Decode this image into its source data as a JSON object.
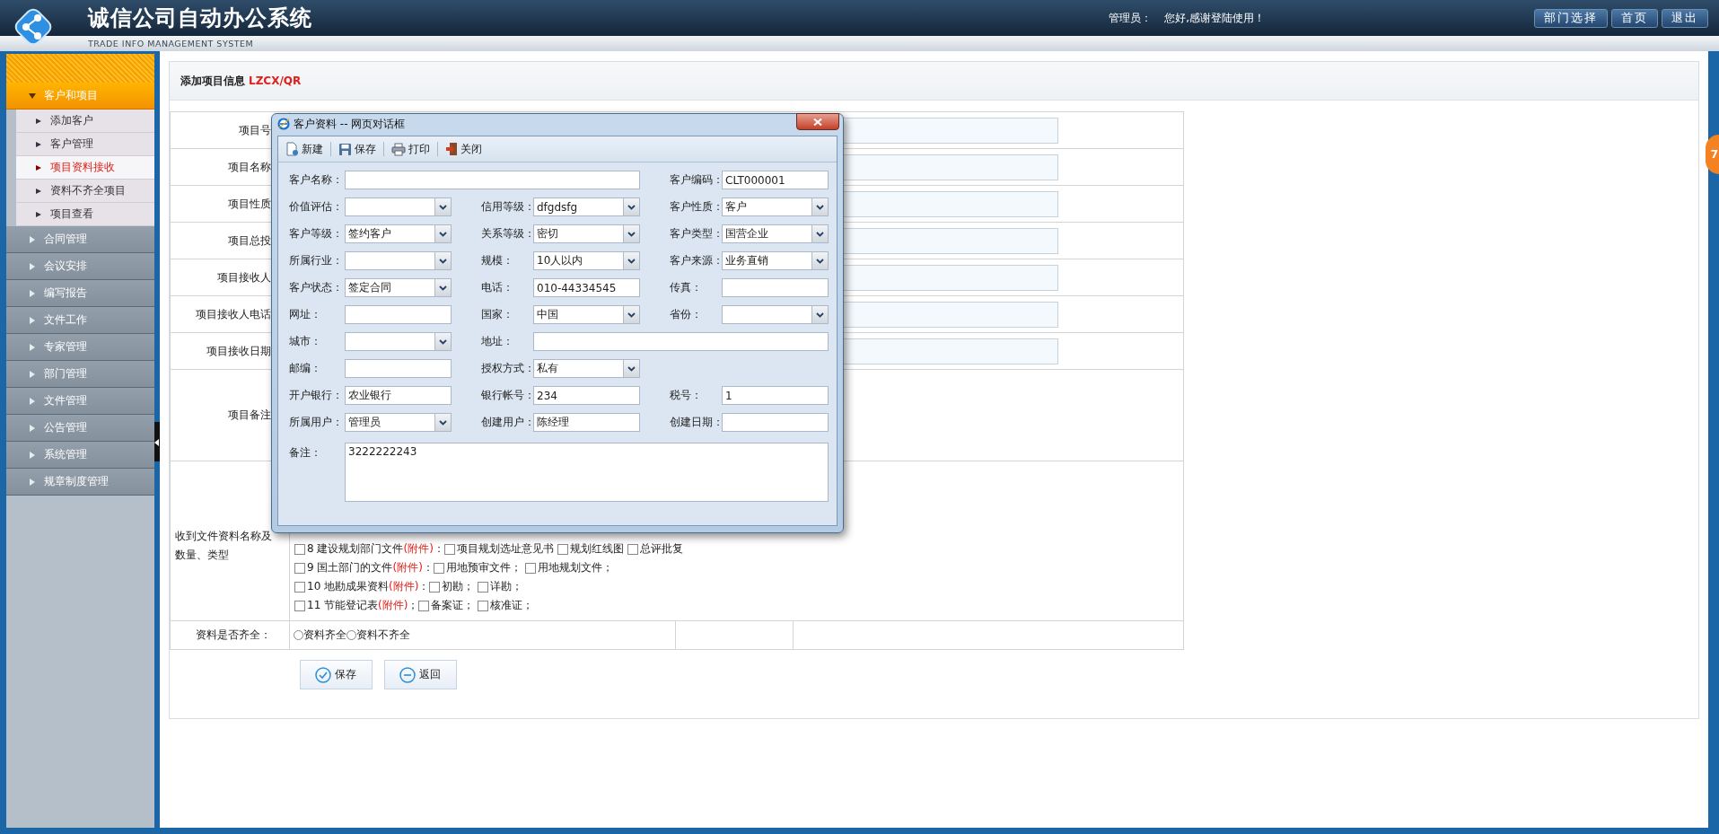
{
  "header": {
    "title": "诚信公司自动办公系统",
    "subtitle": "TRADE INFO MANAGEMENT SYSTEM",
    "user_label": "管理员：",
    "greeting": "您好,感谢登陆使用！",
    "buttons": [
      "部门选择",
      "首页",
      "退出"
    ]
  },
  "sidebar": {
    "groups": [
      {
        "label": "客户和项目",
        "expanded": true,
        "children": [
          {
            "label": "添加客户",
            "selected": false
          },
          {
            "label": "客户管理",
            "selected": false
          },
          {
            "label": "项目资料接收",
            "selected": true
          },
          {
            "label": "资料不齐全项目",
            "selected": false
          },
          {
            "label": "项目查看",
            "selected": false
          }
        ]
      },
      {
        "label": "合同管理",
        "expanded": false
      },
      {
        "label": "会议安排",
        "expanded": false
      },
      {
        "label": "编写报告",
        "expanded": false
      },
      {
        "label": "文件工作",
        "expanded": false
      },
      {
        "label": "专家管理",
        "expanded": false
      },
      {
        "label": "部门管理",
        "expanded": false
      },
      {
        "label": "文件管理",
        "expanded": false
      },
      {
        "label": "公告管理",
        "expanded": false
      },
      {
        "label": "系统管理",
        "expanded": false
      },
      {
        "label": "规章制度管理",
        "expanded": false
      }
    ]
  },
  "panel": {
    "title": "添加项目信息",
    "code": "LZCX/QR"
  },
  "form": {
    "rows": [
      {
        "label": "项目号",
        "kind": "input"
      },
      {
        "label": "项目名称",
        "kind": "input"
      },
      {
        "label": "项目性质",
        "kind": "input"
      },
      {
        "label": "项目总投",
        "kind": "input"
      },
      {
        "label": "项目接收人",
        "kind": "input"
      },
      {
        "label": "项目接收人电话",
        "kind": "input"
      },
      {
        "label": "项目接收日期",
        "kind": "input"
      },
      {
        "label": "项目备注",
        "kind": "notes"
      }
    ],
    "files": {
      "label": "收到文件资料名称及数量、类型",
      "items": [
        {
          "checked": false,
          "title": "8 建设规划部门文件",
          "attachment": "(附件)",
          "sep": "：",
          "options": [
            {
              "label": "项目规划选址意见书",
              "checked": false
            },
            {
              "label": "规划红线图",
              "checked": false
            },
            {
              "label": "总评批复",
              "checked": false
            }
          ]
        },
        {
          "checked": false,
          "title": "9 国土部门的文件",
          "attachment": "(附件)",
          "sep": "：",
          "options": [
            {
              "label": "用地预审文件；",
              "checked": false
            },
            {
              "label": "用地规划文件；",
              "checked": false
            }
          ]
        },
        {
          "checked": false,
          "title": "10 地勘成果资料",
          "attachment": "(附件)",
          "sep": "：",
          "options": [
            {
              "label": "初勘；",
              "checked": false
            },
            {
              "label": "详勘；",
              "checked": false
            }
          ]
        },
        {
          "checked": false,
          "title": "11 节能登记表",
          "attachment": "(附件)",
          "sep": "；",
          "options": [
            {
              "label": "备案证；",
              "checked": false
            },
            {
              "label": "核准证；",
              "checked": false
            }
          ]
        }
      ]
    },
    "completeness": {
      "label": "资料是否齐全：",
      "options": [
        {
          "label": "资料齐全",
          "selected": false
        },
        {
          "label": "资料不齐全",
          "selected": false
        }
      ]
    },
    "buttons": [
      {
        "label": "保存",
        "kind": "save"
      },
      {
        "label": "返回",
        "kind": "back"
      }
    ]
  },
  "dialog": {
    "title": "客户资料 -- 网页对话框",
    "toolbar": [
      {
        "label": "新建",
        "kind": "new"
      },
      {
        "label": "保存",
        "kind": "save"
      },
      {
        "label": "打印",
        "kind": "print"
      },
      {
        "label": "关闭",
        "kind": "close"
      }
    ],
    "rows": [
      [
        {
          "label": "客户名称：",
          "kind": "wide_text"
        },
        "",
        {
          "label": "客户编码：",
          "kind": "text",
          "value": "CLT000001"
        }
      ],
      [
        {
          "label": "价值评估：",
          "kind": "select"
        },
        {
          "label": "信用等级：",
          "kind": "select",
          "value": "dfgdsfg"
        },
        {
          "label": "客户性质：",
          "kind": "select",
          "value": "客户"
        }
      ],
      [
        {
          "label": "客户等级：",
          "kind": "select",
          "value": "签约客户"
        },
        {
          "label": "关系等级：",
          "kind": "select",
          "value": "密切"
        },
        {
          "label": "客户类型：",
          "kind": "select",
          "value": "国营企业"
        }
      ],
      [
        {
          "label": "所属行业：",
          "kind": "select"
        },
        {
          "label": "规模：",
          "kind": "select",
          "value": "10人以内"
        },
        {
          "label": "客户来源：",
          "kind": "select",
          "value": "业务直销"
        }
      ],
      [
        {
          "label": "客户状态：",
          "kind": "select",
          "value": "签定合同"
        },
        {
          "label": "电话：",
          "kind": "text",
          "value": "010-44334545"
        },
        {
          "label": "传真：",
          "kind": "text"
        }
      ],
      [
        {
          "label": "网址：",
          "kind": "text"
        },
        {
          "label": "国家：",
          "kind": "select",
          "value": "中国"
        },
        {
          "label": "省份：",
          "kind": "select"
        }
      ],
      [
        {
          "label": "城市：",
          "kind": "select"
        },
        {
          "label": "地址：",
          "kind": "wide_text"
        }
      ],
      [
        {
          "label": "邮编：",
          "kind": "text"
        },
        {
          "label": "授权方式：",
          "kind": "select",
          "value": "私有"
        }
      ],
      [
        {
          "label": "开户银行：",
          "kind": "text",
          "value": "农业银行"
        },
        {
          "label": "银行帐号：",
          "kind": "text",
          "value": "234"
        },
        {
          "label": "税号：",
          "kind": "text",
          "value": "1"
        }
      ],
      [
        {
          "label": "所属用户：",
          "kind": "select",
          "value": "管理员"
        },
        {
          "label": "创建用户：",
          "kind": "text",
          "value": "陈经理"
        },
        {
          "label": "创建日期：",
          "kind": "text"
        }
      ],
      [
        {
          "label": "备注：",
          "kind": "textarea",
          "value": "3222222243"
        }
      ]
    ]
  },
  "badge": "7"
}
